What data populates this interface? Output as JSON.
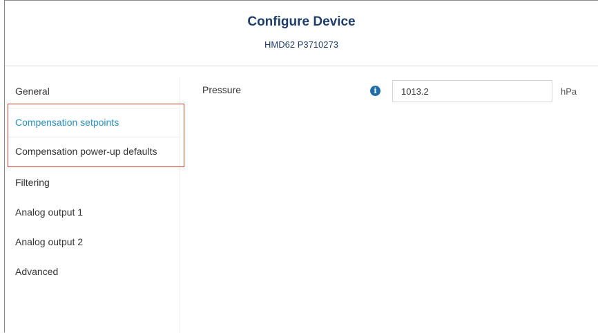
{
  "header": {
    "title": "Configure Device",
    "subtitle": "HMD62 P3710273"
  },
  "sidebar": {
    "items": [
      {
        "label": "General",
        "active": false
      },
      {
        "label": "Compensation setpoints",
        "active": true
      },
      {
        "label": "Compensation power-up defaults",
        "active": false
      },
      {
        "label": "Filtering",
        "active": false
      },
      {
        "label": "Analog output 1",
        "active": false
      },
      {
        "label": "Analog output 2",
        "active": false
      },
      {
        "label": "Advanced",
        "active": false
      }
    ]
  },
  "main": {
    "pressure": {
      "label": "Pressure",
      "value": "1013.2",
      "unit": "hPa",
      "info_icon": "info-icon"
    }
  },
  "colors": {
    "title": "#1f3d6b",
    "active_nav": "#2a8fbd",
    "highlight_box": "#c0392b",
    "info_icon": "#1e6fa8"
  }
}
